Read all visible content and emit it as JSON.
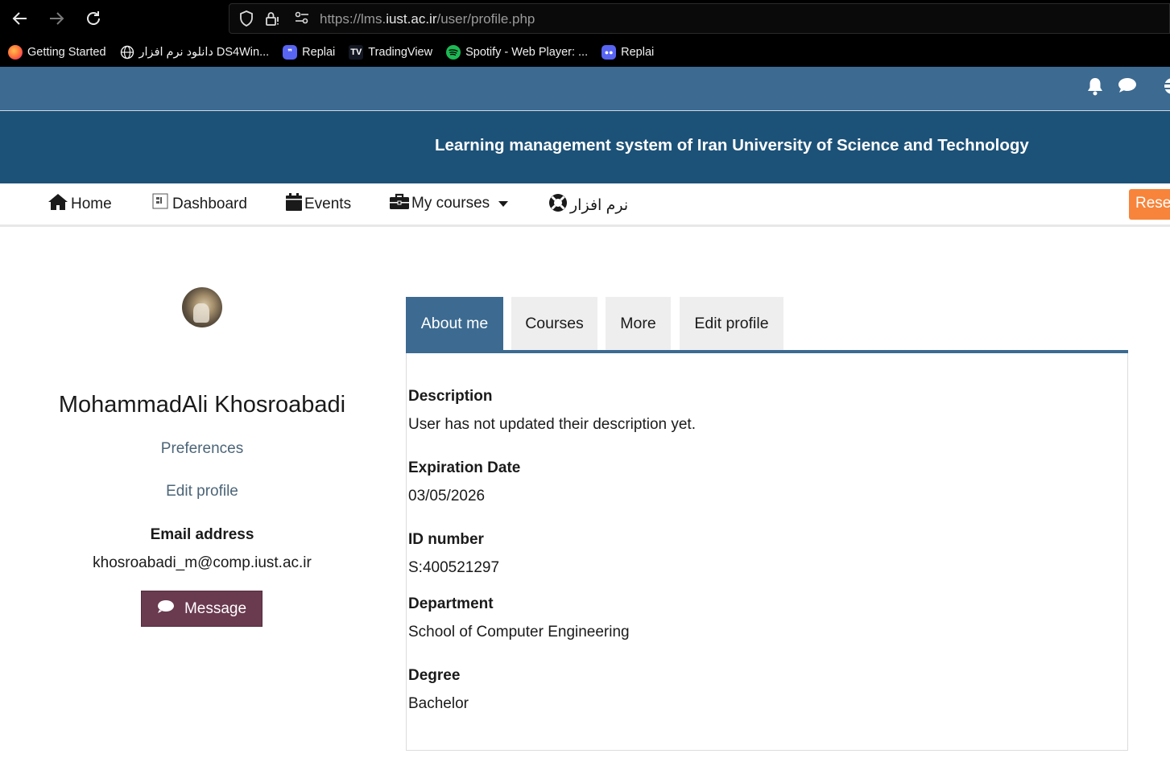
{
  "browser": {
    "url_prefix": "https://lms.",
    "url_host": "iust.ac.ir",
    "url_path": "/user/profile.php",
    "bookmarks": [
      {
        "label": "Getting Started",
        "icon": "firefox-icon",
        "color": "#ff7139"
      },
      {
        "label": "دانلود نرم افزار DS4Win...",
        "icon": "globe-icon",
        "color": "#000000"
      },
      {
        "label": "Replai",
        "icon": "replai-icon",
        "color": "#5865f2"
      },
      {
        "label": "TradingView",
        "icon": "tradingview-icon",
        "color": "#131722"
      },
      {
        "label": "Spotify - Web Player: ...",
        "icon": "spotify-icon",
        "color": "#1db954"
      },
      {
        "label": "Replai",
        "icon": "replai-icon",
        "color": "#5865f2"
      }
    ]
  },
  "header": {
    "banner_title": "Learning management system of Iran University of Science and Technology",
    "topbar_color": "#3c6a91",
    "banner_color": "#1d5278"
  },
  "nav": {
    "items": [
      {
        "label": "Home",
        "icon": "home-icon"
      },
      {
        "label": "Dashboard",
        "icon": "dashboard-icon"
      },
      {
        "label": "Events",
        "icon": "calendar-icon"
      },
      {
        "label": "My courses",
        "icon": "briefcase-icon"
      },
      {
        "label": "نرم افزار",
        "icon": "life-ring-icon"
      }
    ],
    "reset_label": "Rese"
  },
  "profile": {
    "name": "MohammadAli Khosroabadi",
    "preferences_label": "Preferences",
    "edit_profile_label": "Edit profile",
    "email_label": "Email address",
    "email": "khosroabadi_m@comp.iust.ac.ir",
    "message_label": "Message",
    "message_color": "#6a3a4f"
  },
  "tabs": [
    {
      "label": "About me",
      "active": true
    },
    {
      "label": "Courses",
      "active": false
    },
    {
      "label": "More",
      "active": false
    },
    {
      "label": "Edit profile",
      "active": false
    }
  ],
  "about": {
    "description_label": "Description",
    "description": "User has not updated their description yet.",
    "expiration_label": "Expiration Date",
    "expiration": "03/05/2026",
    "id_label": "ID number",
    "id": "S:400521297",
    "department_label": "Department",
    "department": "School of Computer Engineering",
    "degree_label": "Degree",
    "degree": "Bachelor"
  }
}
